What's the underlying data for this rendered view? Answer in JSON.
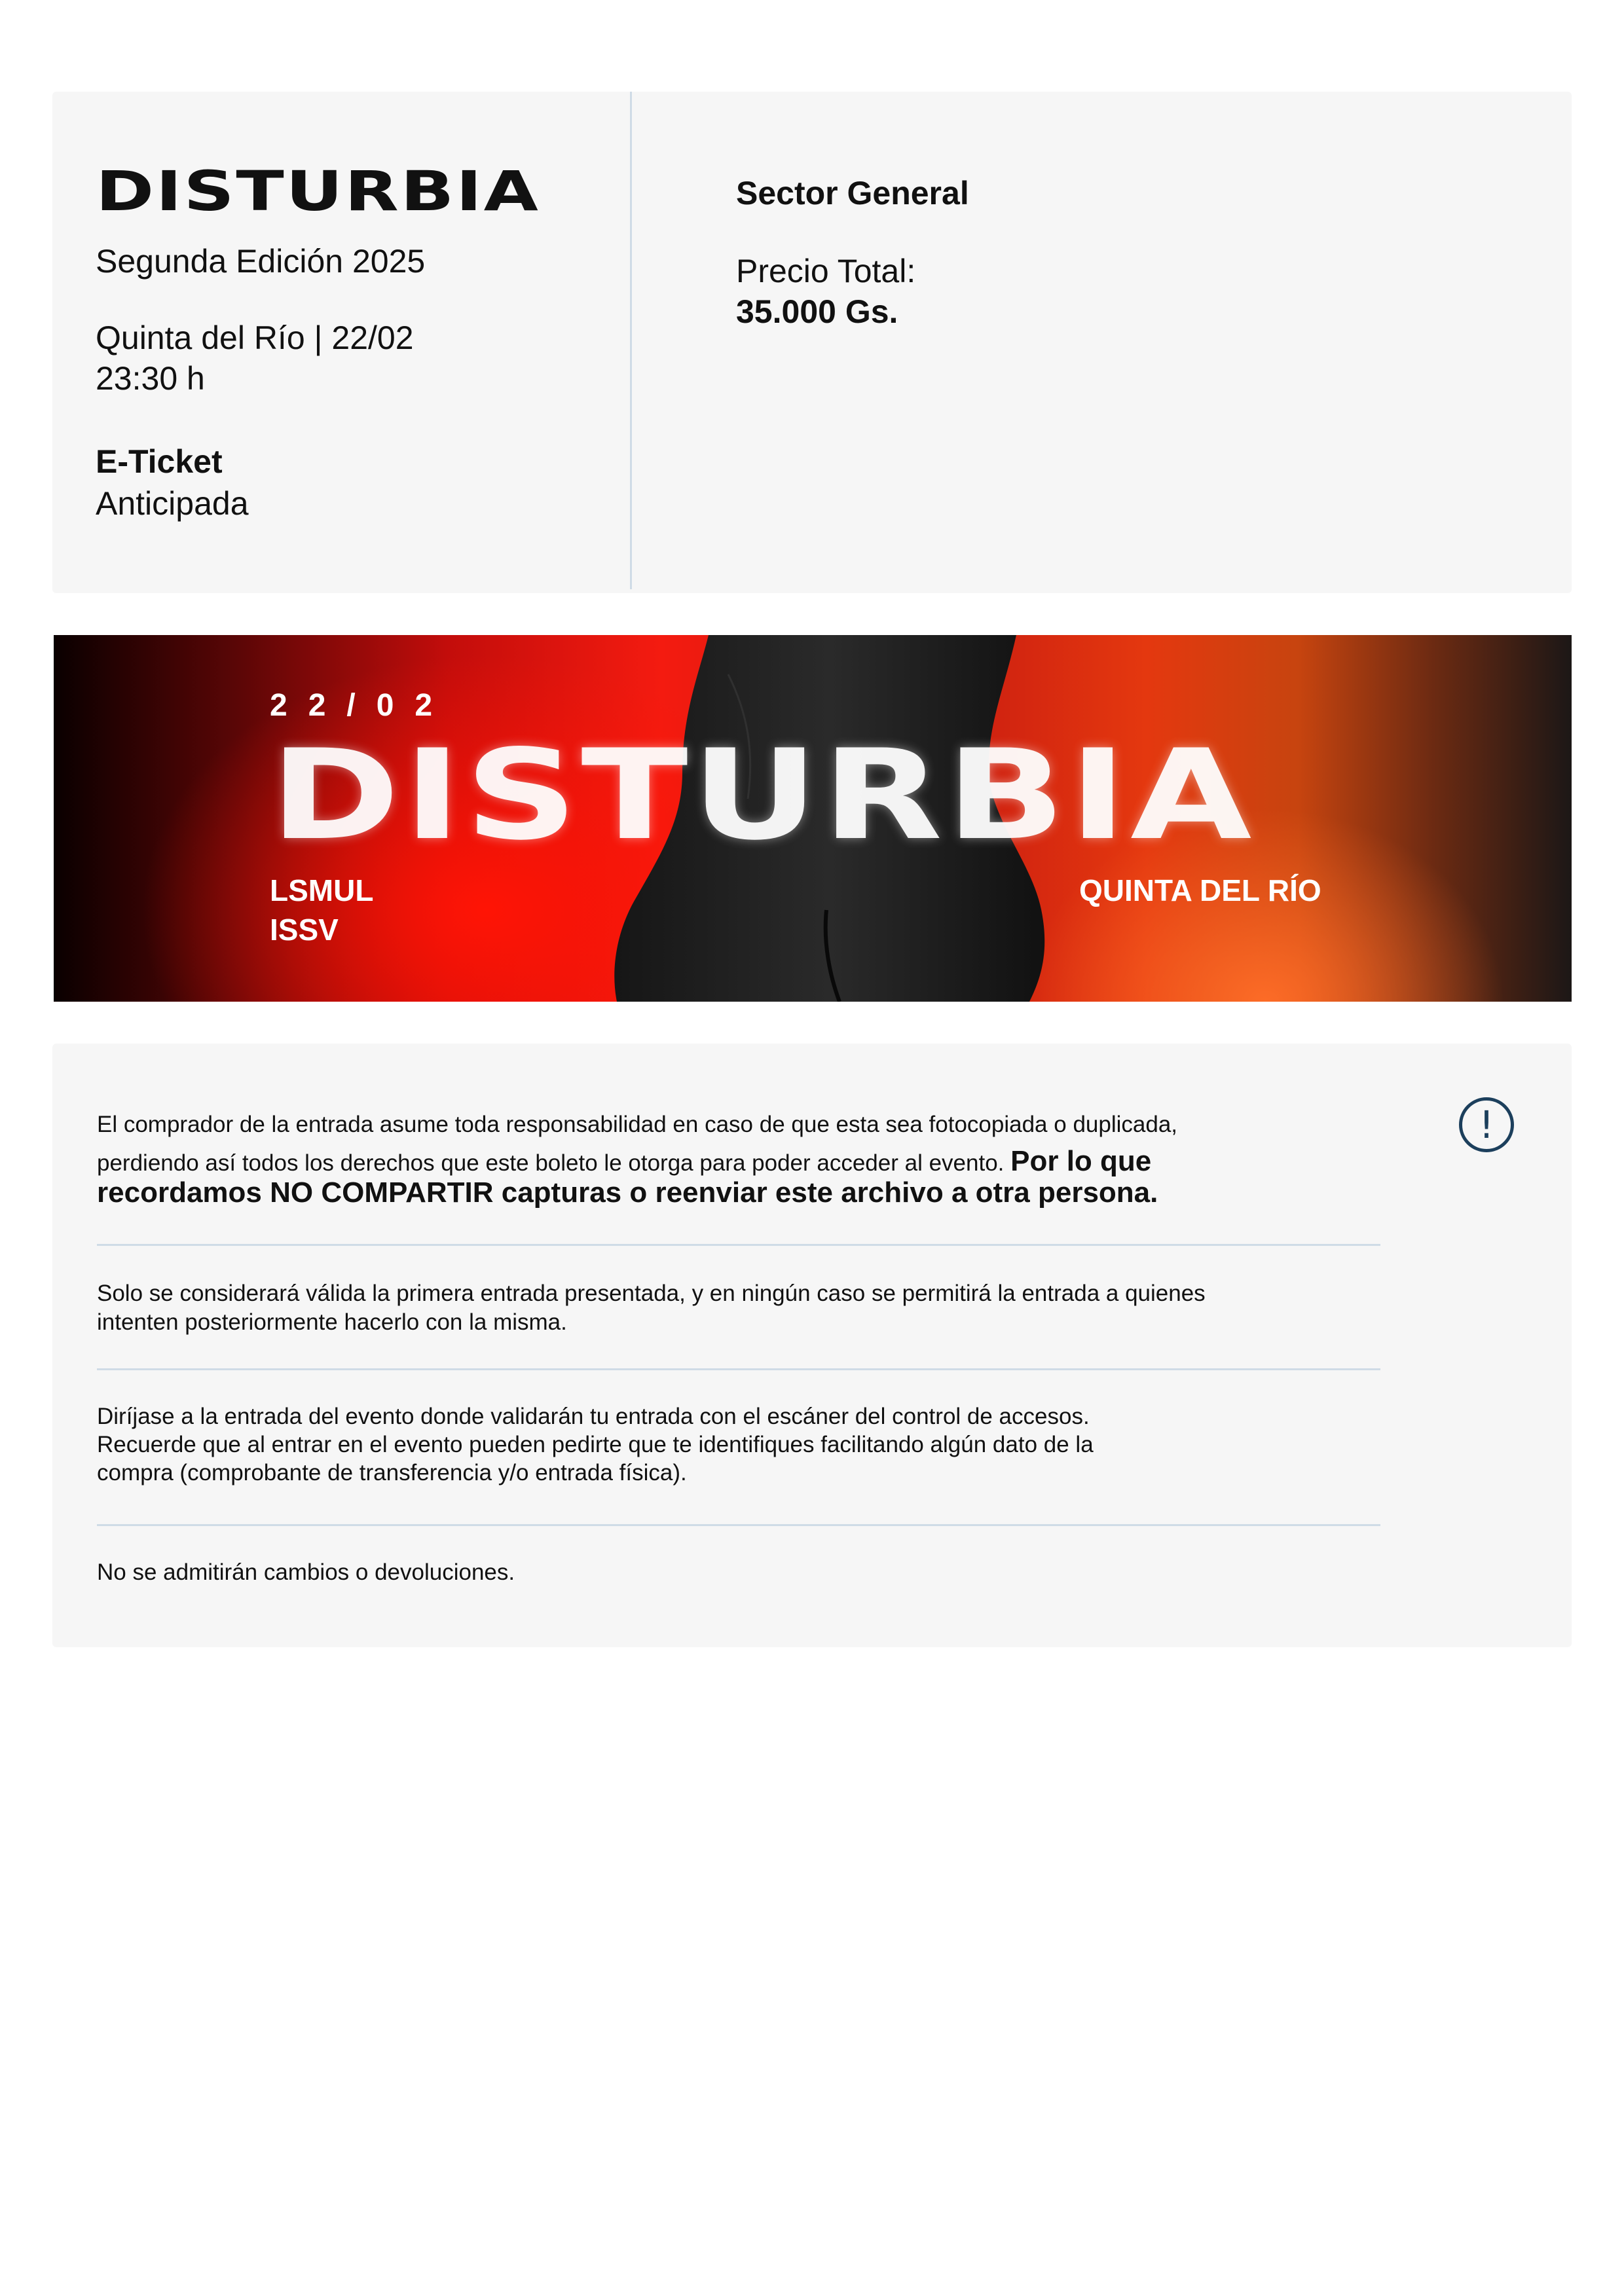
{
  "ticket": {
    "brand": "DISTURBIA",
    "edition": "Segunda Edición 2025",
    "venue_date": "Quinta del Río | 22/02",
    "time": "23:30 h",
    "type_label": "E-Ticket",
    "type_value": "Anticipada",
    "sector": "Sector General",
    "price_label": "Precio Total:",
    "price_value": "35.000 Gs."
  },
  "banner": {
    "date": "22/02",
    "title": "DISTURBIA",
    "artist_1": "LSMUL",
    "artist_2": "ISSV",
    "venue": "QUINTA DEL RÍO"
  },
  "info": {
    "p1_line1": "El comprador de la entrada asume toda responsabilidad en caso de que esta sea fotocopiada o duplicada,",
    "p1_line2": "perdiendo así todos los derechos que este boleto le otorga para poder acceder al evento.",
    "p1_bold_1": "Por lo que",
    "p1_bold_2": "recordamos NO COMPARTIR capturas o reenviar este archivo a otra persona.",
    "p2_line1": "Solo se considerará válida la primera entrada presentada, y en ningún caso se permitirá la entrada a quienes",
    "p2_line2": "intenten posteriormente hacerlo con la misma.",
    "p3_line1": "Diríjase a la entrada del evento donde validarán tu entrada con el escáner del control de accesos.",
    "p3_line2": "Recuerde que al entrar en el evento pueden pedirte que te identifiques facilitando algún dato de la",
    "p3_line3": "compra (comprobante de transferencia y/o entrada física).",
    "p4": "No se admitirán cambios o devoluciones.",
    "alert_glyph": "!",
    "alert_icon": "exclamation-circle-icon"
  }
}
